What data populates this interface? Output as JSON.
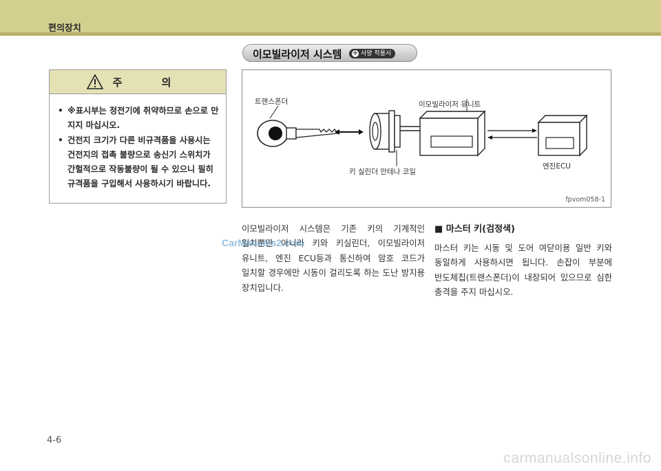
{
  "header": {
    "title": "편의장치"
  },
  "section": {
    "title": "이모빌라이저 시스템",
    "badge": "사양 적용시"
  },
  "caution": {
    "title": "주 의",
    "items": [
      "※표시부는 정전기에 취약하므로 손으로 만지지 마십시오.",
      "건전지 크기가 다른 비규격품을 사용시는 건전지의 접촉 불량으로 송신기 스위치가 간헐적으로 작동불량이 될 수 있으니 필히 규격품을 구입해서 사용하시기 바랍니다."
    ]
  },
  "figure": {
    "label_transponder": "트랜스폰더",
    "label_immobilizer_unit": "이모빌라이저 유니트",
    "label_coil": "키 실린더 안테나 코일",
    "label_ecu": "엔진ECU",
    "figure_id": "fpvom058-1"
  },
  "body": {
    "left_paragraph": "이모빌라이저 시스템은 기존 키의 기계적인 일치뿐만 아니라 키와 키실린더, 이모빌라이저 유니트, 엔진 ECU등과 통신하여 암호 코드가 일치할 경우에만 시동이 걸리도록 하는 도난 방지용 장치입니다.",
    "master_key_heading": "■ 마스터 키(검정색)",
    "right_paragraph": "마스터 키는 시동 및 도어 여닫이용 일반 키와 동일하게 사용하시면 됩니다. 손잡이 부분에 반도체칩(트랜스폰더)이 내장되어 있으므로 심한 충격을 주지 마십시오."
  },
  "watermark": "CarManuals2.com",
  "page_number": "4-6",
  "footer_watermark": "carmanualsonline.info"
}
